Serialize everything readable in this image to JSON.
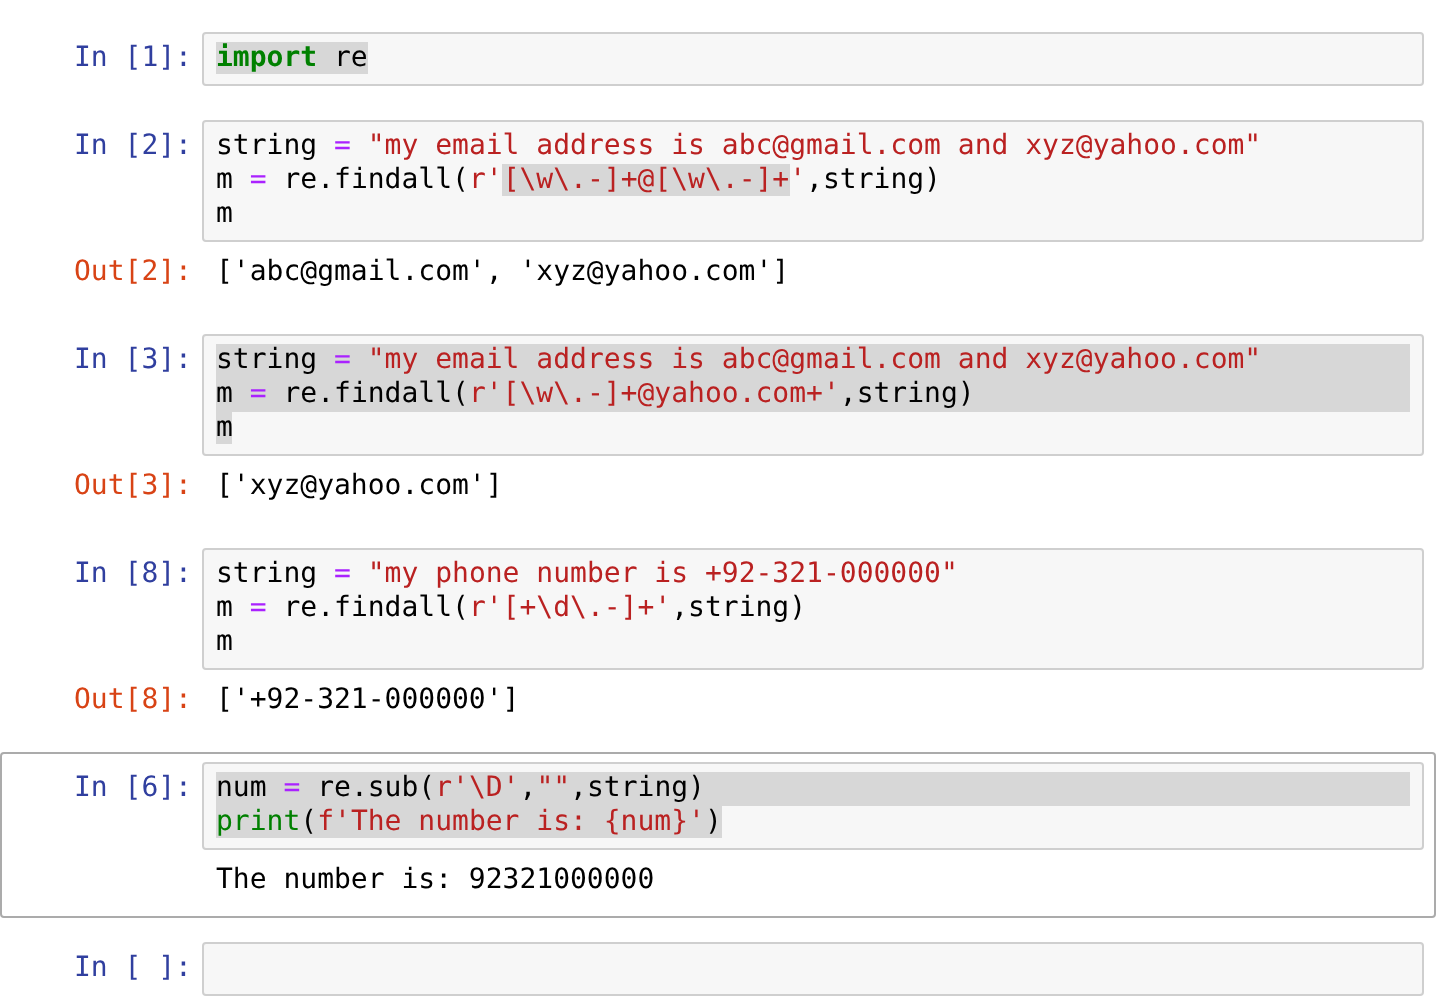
{
  "cells": [
    {
      "prompt": "In [1]:",
      "selected": false,
      "lines": [
        {
          "kind": "text",
          "tokens": [
            {
              "text": "import",
              "kind": "keyword"
            },
            {
              "text": " re",
              "kind": "name"
            }
          ]
        }
      ]
    },
    {
      "prompt": "In [2]:",
      "selected": false,
      "lines": [
        {
          "kind": "none",
          "tokens": [
            {
              "text": "string ",
              "kind": "name"
            },
            {
              "text": "=",
              "kind": "operator"
            },
            {
              "text": " \"my email address is abc@gmail.com and xyz@yahoo.com\"",
              "kind": "string"
            }
          ]
        },
        {
          "kind": "partial",
          "tokens": [
            {
              "text": "m ",
              "kind": "name",
              "highlighted": false
            },
            {
              "text": "=",
              "kind": "operator",
              "highlighted": false
            },
            {
              "text": " re.findall(",
              "kind": "name",
              "highlighted": false
            },
            {
              "text": "r'",
              "kind": "string",
              "highlighted": false
            },
            {
              "text": "[\\w\\.-]+@[\\w\\.-]+",
              "kind": "string",
              "highlighted": true
            },
            {
              "text": "'",
              "kind": "string",
              "highlighted": false
            },
            {
              "text": ",string)",
              "kind": "name",
              "highlighted": false
            }
          ]
        },
        {
          "kind": "none",
          "tokens": [
            {
              "text": "m",
              "kind": "name"
            }
          ]
        }
      ],
      "outputs": [
        {
          "kind": "result",
          "prompt": "Out[2]:",
          "text": "['abc@gmail.com', 'xyz@yahoo.com']"
        }
      ]
    },
    {
      "prompt": "In [3]:",
      "selected": false,
      "lines": [
        {
          "kind": "full",
          "tokens": [
            {
              "text": "string ",
              "kind": "name"
            },
            {
              "text": "=",
              "kind": "operator"
            },
            {
              "text": " \"my email address is abc@gmail.com and xyz@yahoo.com\"",
              "kind": "string"
            }
          ]
        },
        {
          "kind": "full",
          "tokens": [
            {
              "text": "m ",
              "kind": "name"
            },
            {
              "text": "=",
              "kind": "operator"
            },
            {
              "text": " re.findall(",
              "kind": "name"
            },
            {
              "text": "r'[\\w\\.-]+@yahoo.com+'",
              "kind": "string"
            },
            {
              "text": ",string)",
              "kind": "name"
            }
          ]
        },
        {
          "kind": "text",
          "tokens": [
            {
              "text": "m",
              "kind": "name"
            }
          ]
        }
      ],
      "outputs": [
        {
          "kind": "result",
          "prompt": "Out[3]:",
          "text": "['xyz@yahoo.com']"
        }
      ]
    },
    {
      "prompt": "In [8]:",
      "selected": false,
      "lines": [
        {
          "kind": "none",
          "tokens": [
            {
              "text": "string ",
              "kind": "name"
            },
            {
              "text": "=",
              "kind": "operator"
            },
            {
              "text": " \"my phone number is +92-321-000000\"",
              "kind": "string"
            }
          ]
        },
        {
          "kind": "none",
          "tokens": [
            {
              "text": "m ",
              "kind": "name"
            },
            {
              "text": "=",
              "kind": "operator"
            },
            {
              "text": " re.findall(",
              "kind": "name"
            },
            {
              "text": "r'[+\\d\\.-]+'",
              "kind": "string"
            },
            {
              "text": ",string)",
              "kind": "name"
            }
          ]
        },
        {
          "kind": "none",
          "tokens": [
            {
              "text": "m",
              "kind": "name"
            }
          ]
        }
      ],
      "outputs": [
        {
          "kind": "result",
          "prompt": "Out[8]:",
          "text": "['+92-321-000000']"
        }
      ]
    },
    {
      "prompt": "In [6]:",
      "selected": true,
      "lines": [
        {
          "kind": "full",
          "tokens": [
            {
              "text": "num ",
              "kind": "name"
            },
            {
              "text": "=",
              "kind": "operator"
            },
            {
              "text": " re.sub(",
              "kind": "name"
            },
            {
              "text": "r'\\D'",
              "kind": "string"
            },
            {
              "text": ",",
              "kind": "name"
            },
            {
              "text": "\"\"",
              "kind": "string"
            },
            {
              "text": ",string)",
              "kind": "name"
            }
          ]
        },
        {
          "kind": "text",
          "tokens": [
            {
              "text": "print",
              "kind": "builtin"
            },
            {
              "text": "(",
              "kind": "name"
            },
            {
              "text": "f'The number is: {num}'",
              "kind": "string"
            },
            {
              "text": ")",
              "kind": "name"
            }
          ]
        }
      ],
      "outputs": [
        {
          "kind": "stream",
          "text": "The number is: 92321000000"
        }
      ]
    },
    {
      "prompt": "In [ ]:",
      "selected": false
    }
  ]
}
